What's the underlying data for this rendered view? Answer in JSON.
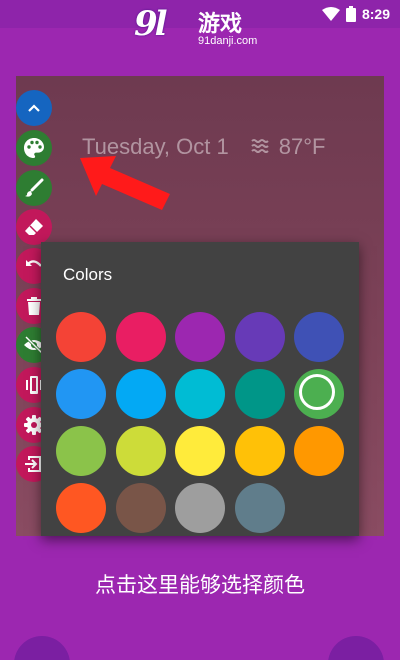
{
  "status_bar": {
    "time": "8:29"
  },
  "watermark": {
    "logo": "9l",
    "title": "游戏",
    "domain": "91danji.com"
  },
  "lock_preview": {
    "date": "Tuesday, Oct 1",
    "temperature": "87°F",
    "weather_icon": "haze-icon"
  },
  "toolbar": {
    "items": [
      {
        "icon": "chevron-up-icon",
        "color": "#1565c0"
      },
      {
        "icon": "palette-icon",
        "color": "#2e7d32"
      },
      {
        "icon": "brush-icon",
        "color": "#2e7d32"
      },
      {
        "icon": "eraser-icon",
        "color": "#c2185b"
      },
      {
        "icon": "undo-icon",
        "color": "#c2185b"
      },
      {
        "icon": "trash-icon",
        "color": "#c2185b"
      },
      {
        "icon": "eye-off-icon",
        "color": "#2e7d32"
      },
      {
        "icon": "vibrate-icon",
        "color": "#c2185b"
      },
      {
        "icon": "gear-icon",
        "color": "#c2185b"
      },
      {
        "icon": "exit-icon",
        "color": "#c2185b"
      }
    ]
  },
  "colors_panel": {
    "title": "Colors",
    "selected": "#4caf50",
    "swatches": [
      "#f44336",
      "#e91e63",
      "#9c27b0",
      "#673ab7",
      "#3f51b5",
      "#2196f3",
      "#03a9f4",
      "#00bcd4",
      "#009688",
      "#4caf50",
      "#8bc34a",
      "#cddc39",
      "#ffeb3b",
      "#ffc107",
      "#ff9800",
      "#ff5722",
      "#795548",
      "#9e9e9e",
      "#607d8b"
    ]
  },
  "caption": "点击这里能够选择颜色",
  "annotation_arrow_color": "#ff1a1a"
}
